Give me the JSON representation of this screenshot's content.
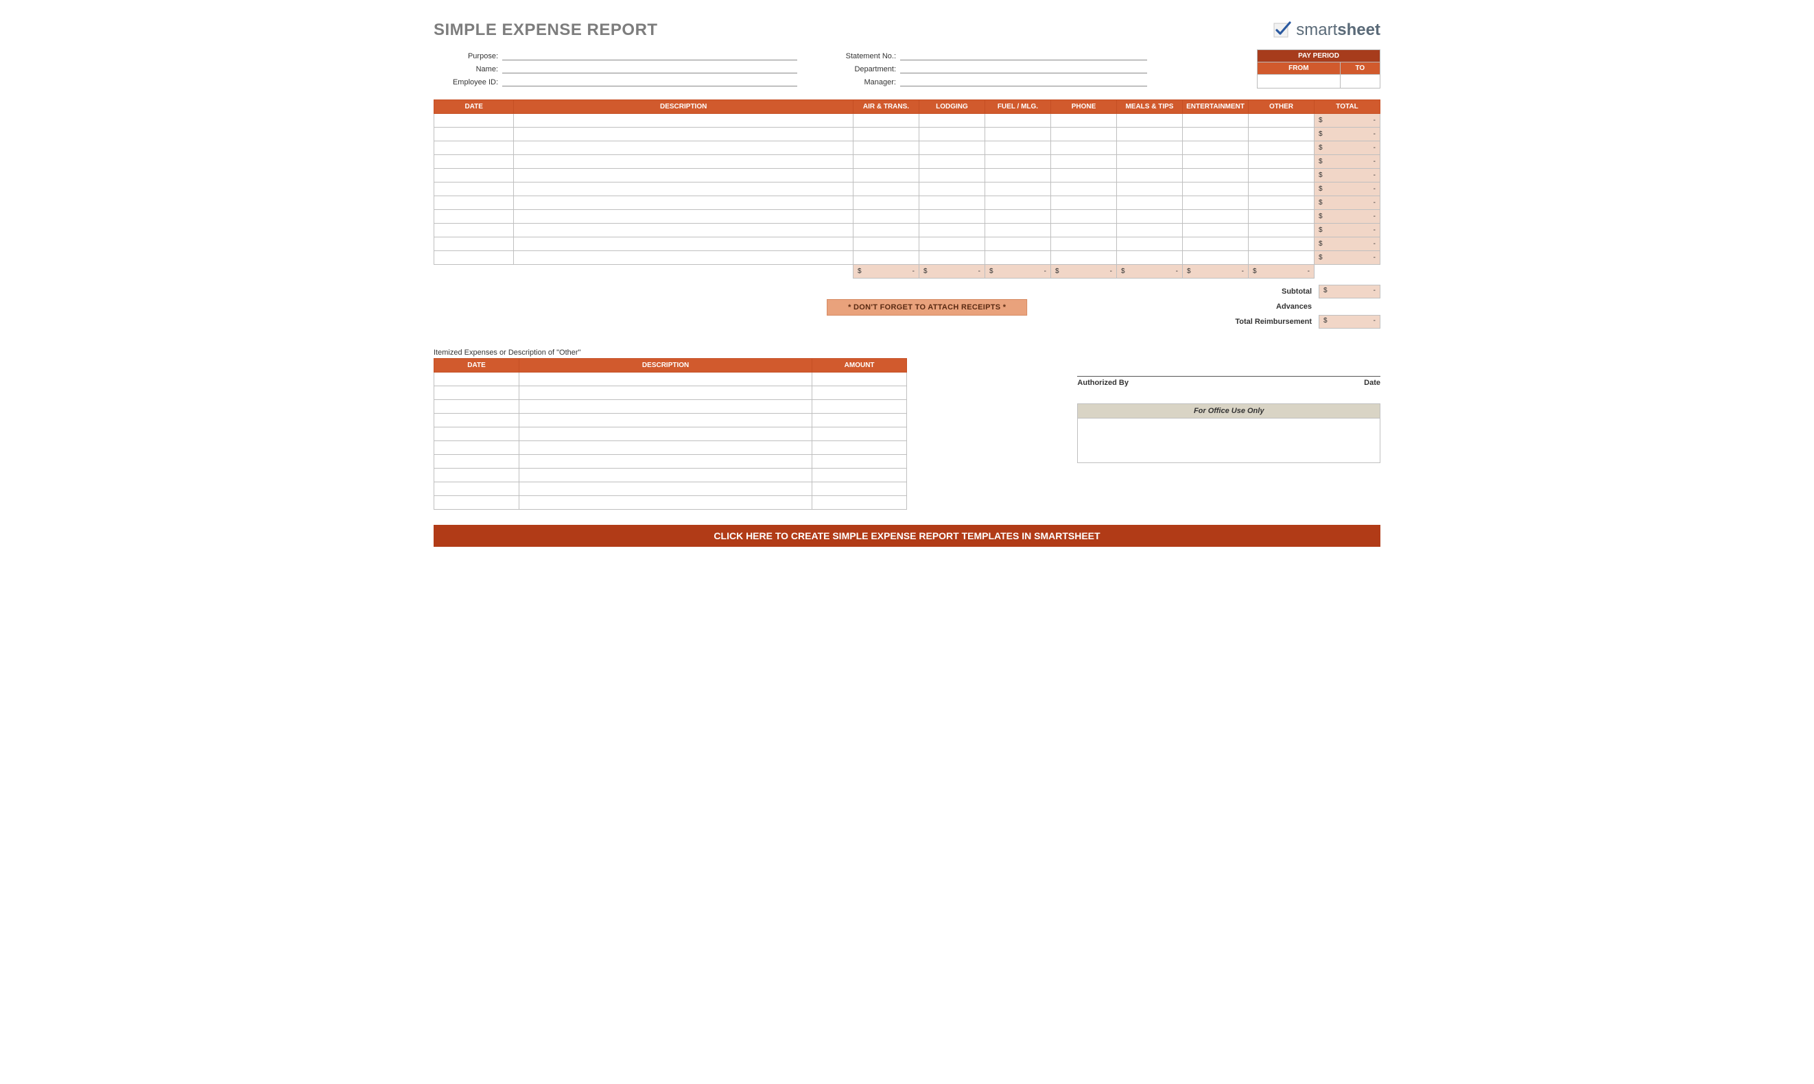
{
  "title": "SIMPLE EXPENSE REPORT",
  "logo": {
    "text_prefix": "smart",
    "text_bold": "sheet"
  },
  "info": {
    "left": [
      {
        "label": "Purpose:"
      },
      {
        "label": "Name:"
      },
      {
        "label": "Employee ID:"
      }
    ],
    "right": [
      {
        "label": "Statement No.:"
      },
      {
        "label": "Department:"
      },
      {
        "label": "Manager:"
      }
    ]
  },
  "pay_period": {
    "title": "PAY PERIOD",
    "from": "FROM",
    "to": "TO"
  },
  "expense_headers": [
    "DATE",
    "DESCRIPTION",
    "AIR & TRANS.",
    "LODGING",
    "FUEL / MLG.",
    "PHONE",
    "MEALS & TIPS",
    "ENTERTAINMENT",
    "OTHER",
    "TOTAL"
  ],
  "expense_row_count": 11,
  "row_total": {
    "sym": "$",
    "dash": "-"
  },
  "col_subtotal": {
    "sym": "$",
    "dash": "-"
  },
  "summary": {
    "subtotal_label": "Subtotal",
    "advances_label": "Advances",
    "total_reimb_label": "Total Reimbursement",
    "sym": "$",
    "dash": "-"
  },
  "receipts_note": "* DON'T FORGET TO ATTACH RECEIPTS *",
  "itemized": {
    "title": "Itemized Expenses or Description of \"Other\"",
    "headers": [
      "DATE",
      "DESCRIPTION",
      "AMOUNT"
    ],
    "row_count": 10
  },
  "signature": {
    "auth_label": "Authorized By",
    "date_label": "Date",
    "office_title": "For Office Use Only"
  },
  "cta": "CLICK HERE TO CREATE SIMPLE EXPENSE REPORT TEMPLATES IN SMARTSHEET"
}
